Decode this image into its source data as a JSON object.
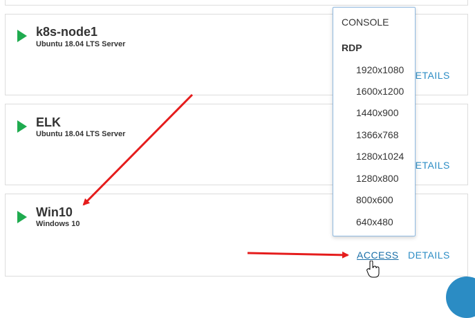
{
  "vms": [
    {
      "name": "k8s-node1",
      "os": "Ubuntu 18.04 LTS Server",
      "details_label": "DETAILS"
    },
    {
      "name": "ELK",
      "os": "Ubuntu 18.04 LTS Server",
      "details_label": "DETAILS"
    },
    {
      "name": "Win10",
      "os": "Windows 10",
      "access_label": "ACCESS",
      "details_label": "DETAILS"
    }
  ],
  "access_menu": {
    "console_label": "CONSOLE",
    "rdp_label": "RDP",
    "resolutions": [
      "1920x1080",
      "1600x1200",
      "1440x900",
      "1366x768",
      "1280x1024",
      "1280x800",
      "800x600",
      "640x480"
    ]
  },
  "colors": {
    "play": "#1fab4f",
    "link": "#2b8cc4",
    "annotation_arrow": "#e51c1c"
  },
  "icons": {
    "status": "play-icon",
    "pointer": "hand-pointer-icon"
  }
}
